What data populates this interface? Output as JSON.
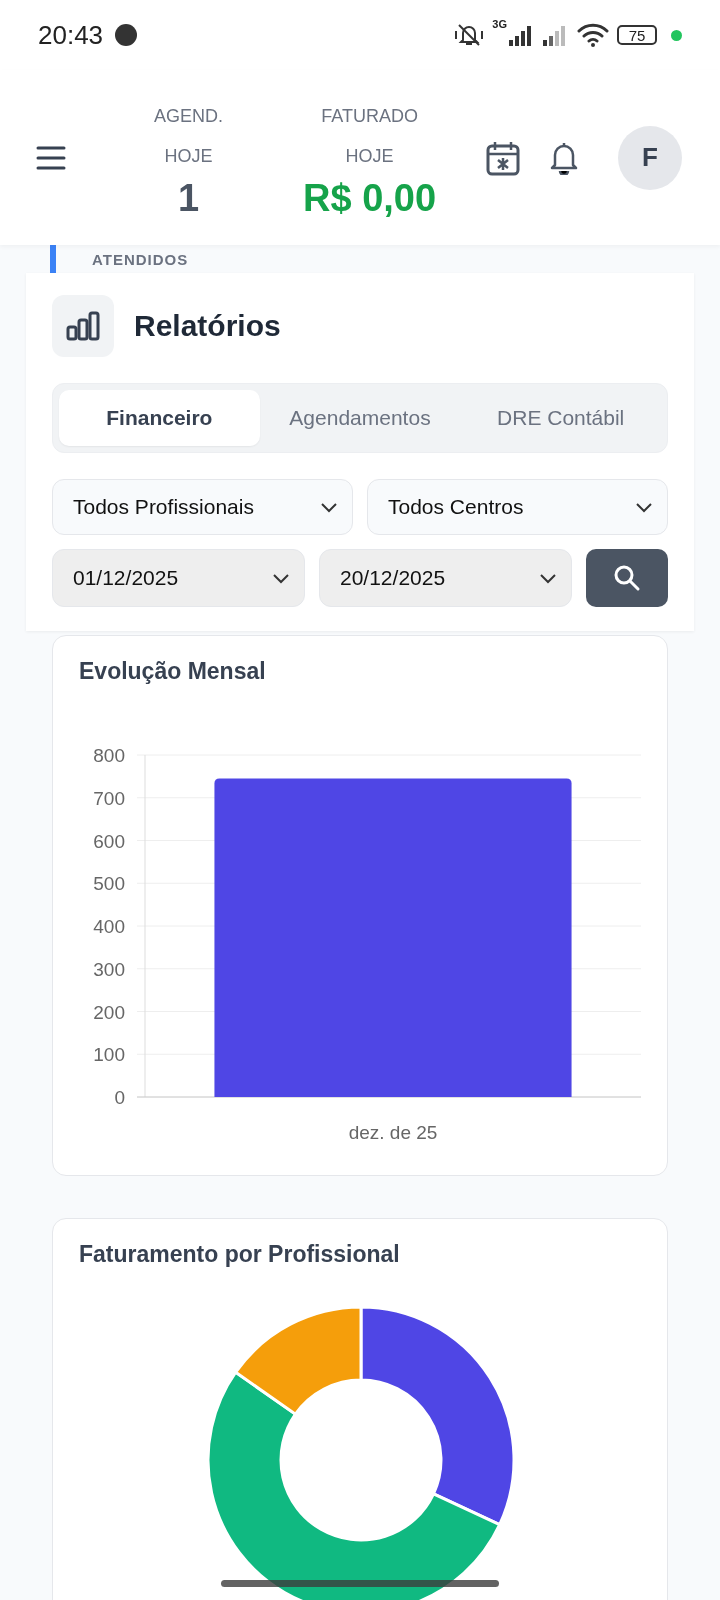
{
  "status_bar": {
    "time": "20:43",
    "network": "3G",
    "battery": "75"
  },
  "header": {
    "stats": [
      {
        "kind": "count",
        "label_1": "AGEND.",
        "label_2": "HOJE",
        "value": "1"
      },
      {
        "kind": "money",
        "label_1": "FATURADO",
        "label_2": "HOJE",
        "value": "R$ 0,00"
      }
    ],
    "avatar": "F"
  },
  "behind_strip": {
    "label": "ATENDIDOS"
  },
  "reports": {
    "title": "Relatórios",
    "tabs": [
      {
        "label": "Financeiro",
        "selected": true
      },
      {
        "label": "Agendamentos",
        "selected": false
      },
      {
        "label": "DRE Contábil",
        "selected": false
      }
    ],
    "filters": [
      {
        "value": "Todos Profissionais"
      },
      {
        "value": "Todos Centros"
      }
    ],
    "dates": [
      {
        "value": "01/12/2025"
      },
      {
        "value": "20/12/2025"
      }
    ]
  },
  "charts": [
    {
      "title": "Evolução Mensal",
      "chart_data": {
        "type": "bar",
        "grid": true,
        "categories": [
          "dez. de 25"
        ],
        "values": [
          745
        ],
        "ylim": [
          0,
          800
        ],
        "yticks": [
          0,
          100,
          200,
          300,
          400,
          500,
          600,
          700,
          800
        ]
      }
    },
    {
      "kind": "donut",
      "title": "Faturamento por Profissional"
    }
  ]
}
